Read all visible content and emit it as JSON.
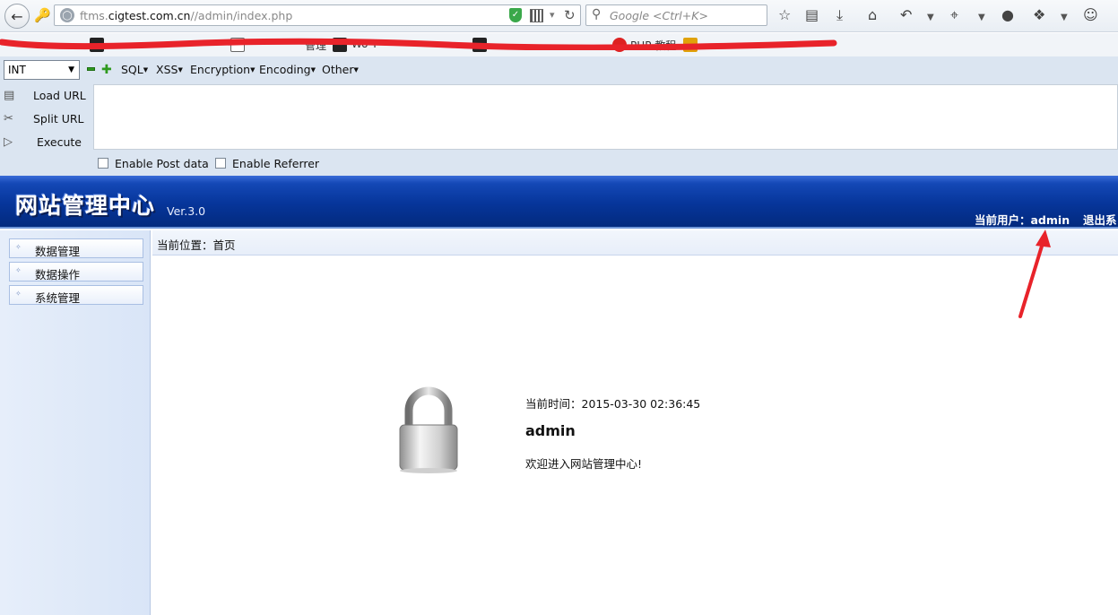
{
  "browser": {
    "url_prefix": "ftms.",
    "url_domain": "cigtest.com.cn",
    "url_path": "//admin/index.php",
    "search_placeholder": "Google <Ctrl+K>"
  },
  "bookmarks": [
    {
      "label": "Wo Y"
    },
    {
      "label": "管理"
    },
    {
      "label": "PHP 教程"
    }
  ],
  "hackbar": {
    "select_value": "INT",
    "menus": [
      "SQL",
      "XSS",
      "Encryption",
      "Encoding",
      "Other"
    ],
    "actions": [
      {
        "label": "Load URL"
      },
      {
        "label": "Split URL"
      },
      {
        "label": "Execute"
      }
    ],
    "enable_post": "Enable Post data",
    "enable_referrer": "Enable Referrer",
    "url_value": ""
  },
  "cms": {
    "logo": "网站管理中心",
    "version": "Ver.3.0",
    "current_user": "当前用户：admin",
    "logout": "退出系"
  },
  "sidebar": {
    "items": [
      {
        "label": "数据管理"
      },
      {
        "label": "数据操作"
      },
      {
        "label": "系统管理"
      }
    ]
  },
  "main": {
    "breadcrumb": "当前位置：首页",
    "time_line": "当前时间：2015-03-30 02:36:45",
    "username": "admin",
    "welcome": "欢迎进入网站管理中心!"
  },
  "colors": {
    "header_blue": "#06359a",
    "hackbar_bg": "#dbe5f1",
    "annotation_red": "#e8232a"
  }
}
